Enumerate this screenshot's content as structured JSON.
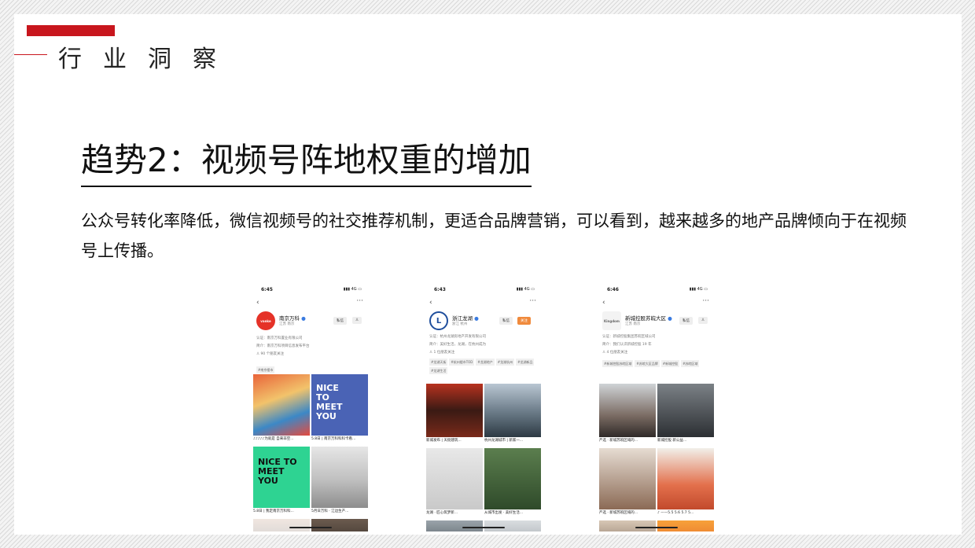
{
  "section_title": "行业洞察",
  "heading": "趋势2：视频号阵地权重的增加",
  "description": "公众号转化率降低，微信视频号的社交推荐机制，更适合品牌营销，可以看到，越来越多的地产品牌倾向于在视频号上传播。",
  "colors": {
    "accent": "#c8161d",
    "follow_button": "#f08a3c"
  },
  "phones": [
    {
      "time": "6:45",
      "signal": "4G",
      "avatar_text": "vanke",
      "avatar_color": "#e53228",
      "account_name": "南京万科",
      "location": "江苏 南京",
      "buttons": [
        "私信",
        "♙"
      ],
      "info": [
        "认证：南京万科置业有限公司",
        "简介：南京万科项目信息发布平台",
        "♙ 90 个朋友关注"
      ],
      "tags": [
        "#南京楼市"
      ],
      "captions": [
        "♪♪♪♪♪为就是 自来非空...",
        "5.8日 | 南京万科科科卡看...",
        "5.8日 | 我定南京万科科...",
        "5月日万科 · 江边生产..."
      ]
    },
    {
      "time": "6:43",
      "signal": "4G",
      "avatar_text": "L",
      "avatar_color": "#1f4e9c",
      "account_name": "浙江龙湖",
      "location": "浙江 杭州",
      "buttons": [
        "私信",
        "关注"
      ],
      "info": [
        "认证：杭州龙湖房地产开发有限公司",
        "简介：美好生活，龙湖，在杭州成为",
        "♙ 1 位朋友关注"
      ],
      "tags": [
        "#龙湖天街",
        "#杭州楼市TOD",
        "#龙湖地产",
        "#龙湖杭州",
        "#龙湖新品",
        "#龙湖生活"
      ],
      "captions": [
        "新城发布 | 天街建筑...",
        "杭州龙湖城市 | 新家一...",
        "龙湖 · 匠心筑梦新...",
        "从城市出发 · 美好生活..."
      ]
    },
    {
      "time": "6:46",
      "signal": "4G",
      "avatar_text": "Kingdom",
      "avatar_color": "#8a8a8a",
      "account_name": "新城控股苏皖大区",
      "location": "江苏 南京",
      "buttons": [
        "私信",
        "♙"
      ],
      "info": [
        "认证：新城控股集团苏皖区域公司",
        "简介：我们认识新城控股 19 年",
        "♙ 4 位朋友关注"
      ],
      "tags": [
        "#新城控股苏皖区域",
        "#苏皖大区品牌",
        "#新城控股",
        "#苏皖区域"
      ],
      "captions": [
        "严选 · 新城苏皖区域的...",
        "新城控股 新公益...",
        "严选 · 新城苏皖区域的...",
        "♪ ——5.5 5.6 5.7 5..."
      ]
    }
  ]
}
